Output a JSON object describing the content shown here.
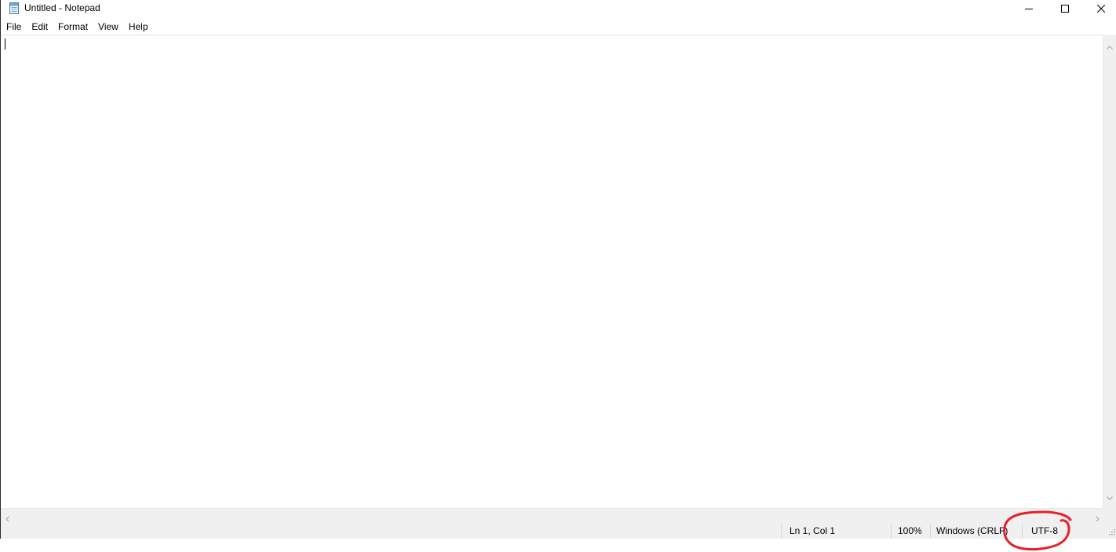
{
  "window": {
    "title": "Untitled - Notepad"
  },
  "caption_buttons": {
    "minimize": "minimize-icon",
    "maximize": "maximize-icon",
    "close": "close-icon"
  },
  "menu": {
    "items": [
      {
        "label": "File"
      },
      {
        "label": "Edit"
      },
      {
        "label": "Format"
      },
      {
        "label": "View"
      },
      {
        "label": "Help"
      }
    ]
  },
  "editor": {
    "content": ""
  },
  "statusbar": {
    "position": "Ln 1, Col 1",
    "zoom": "100%",
    "line_ending": "Windows (CRLF)",
    "encoding": "UTF-8"
  },
  "annotation": {
    "color": "#e8202a",
    "shape": "hand-drawn circle around encoding"
  }
}
